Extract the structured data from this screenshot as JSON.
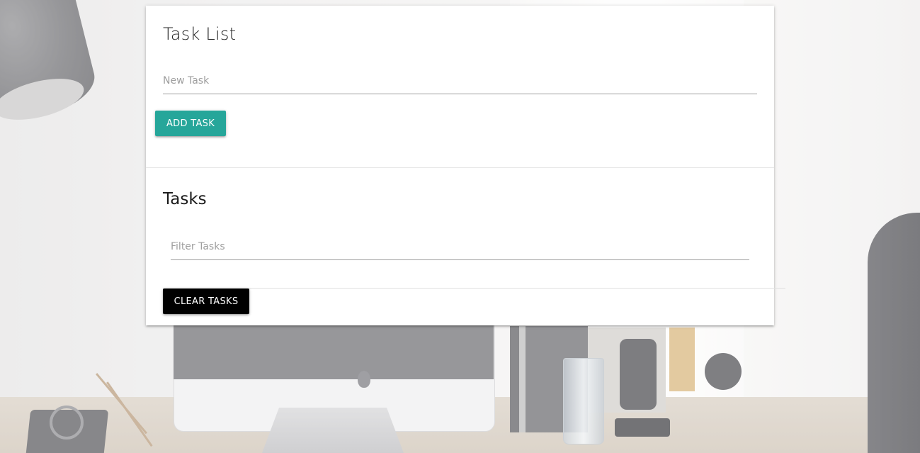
{
  "task_form": {
    "title": "Task List",
    "new_task_placeholder": "New Task",
    "new_task_value": "",
    "add_button_label": "ADD TASK",
    "add_button_color": "#26a69a"
  },
  "tasks_section": {
    "title": "Tasks",
    "filter_placeholder": "Filter Tasks",
    "filter_value": "",
    "items": [],
    "clear_button_label": "CLEAR TASKS",
    "clear_button_color": "#000000"
  }
}
